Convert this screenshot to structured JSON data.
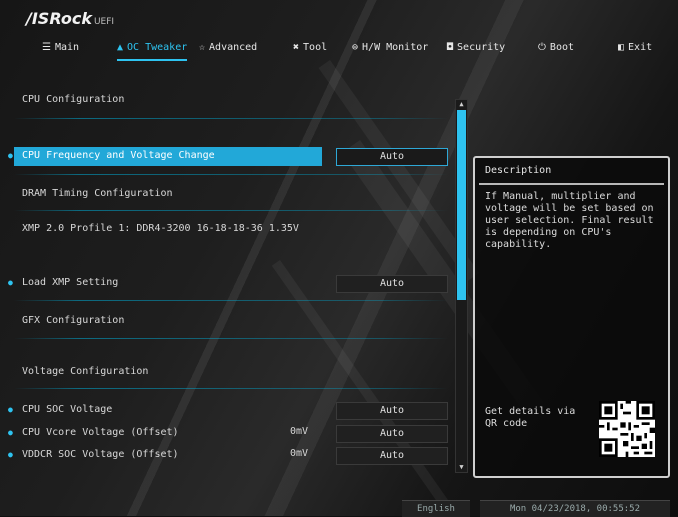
{
  "brand": {
    "name": "/ISRock",
    "sub": "UEFI"
  },
  "nav": [
    {
      "label": "Main",
      "icon": "menu-icon",
      "glyph": "☰"
    },
    {
      "label": "OC Tweaker",
      "icon": "flame-icon",
      "glyph": "▲",
      "active": true
    },
    {
      "label": "Advanced",
      "icon": "star-icon",
      "glyph": "☆"
    },
    {
      "label": "Tool",
      "icon": "tools-icon",
      "glyph": "✖"
    },
    {
      "label": "H/W Monitor",
      "icon": "monitor-icon",
      "glyph": "⊜"
    },
    {
      "label": "Security",
      "icon": "shield-icon",
      "glyph": "◘"
    },
    {
      "label": "Boot",
      "icon": "power-icon",
      "glyph": "⏻"
    },
    {
      "label": "Exit",
      "icon": "exit-icon",
      "glyph": "◧"
    }
  ],
  "items": {
    "cpu_config": "CPU Configuration",
    "cpu_freq": {
      "label": "CPU Frequency and Voltage Change",
      "value": "Auto"
    },
    "dram_timing": "DRAM Timing Configuration",
    "xmp_profile": "XMP 2.0 Profile 1: DDR4-3200 16-18-18-36 1.35V",
    "load_xmp": {
      "label": "Load XMP Setting",
      "value": "Auto"
    },
    "gfx_config": "GFX Configuration",
    "voltage_config": "Voltage Configuration",
    "cpu_soc": {
      "label": "CPU SOC Voltage",
      "value": "Auto"
    },
    "cpu_vcore": {
      "label": "CPU Vcore Voltage (Offset)",
      "reading": "0mV",
      "value": "Auto"
    },
    "vddcr_soc": {
      "label": "VDDCR SOC Voltage (Offset)",
      "reading": "0mV",
      "value": "Auto"
    }
  },
  "description": {
    "title": "Description",
    "text": "If Manual, multiplier and voltage will be set based on user selection. Final result is depending on CPU's capability.",
    "qr_text": "Get details via QR code"
  },
  "footer": {
    "language": "English",
    "datetime": "Mon 04/23/2018, 00:55:52"
  },
  "colors": {
    "accent": "#2ec3f0",
    "highlight": "#22a8d8"
  }
}
